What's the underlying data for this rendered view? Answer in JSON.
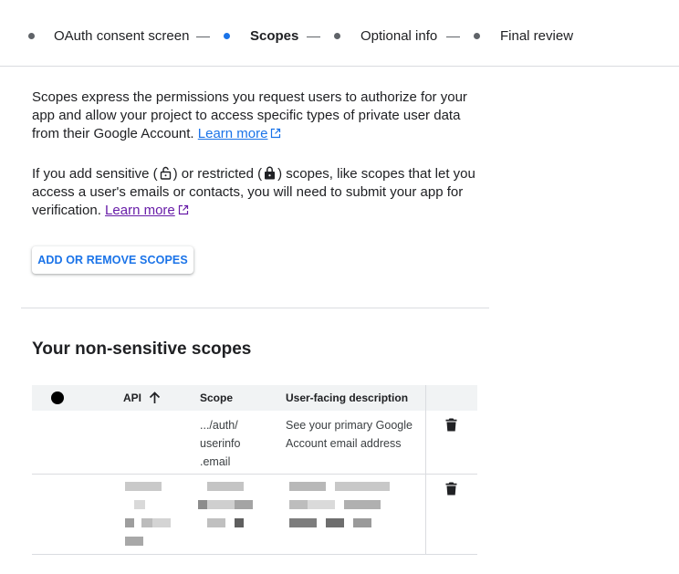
{
  "stepper": {
    "steps": [
      {
        "label": "OAuth consent screen",
        "active": false
      },
      {
        "label": "Scopes",
        "active": true
      },
      {
        "label": "Optional info",
        "active": false
      },
      {
        "label": "Final review",
        "active": false
      }
    ]
  },
  "intro": {
    "p1_text": "Scopes express the permissions you request users to authorize for your app and allow your project to access specific types of private user data from their Google Account.",
    "p1_link": "Learn more",
    "p2_text_a": "If you add sensitive (",
    "p2_text_b": ") or restricted (",
    "p2_text_c": ") scopes, like scopes that let you access a user's emails or contacts, you will need to submit your app for verification.",
    "p2_link": "Learn more"
  },
  "add_button_label": "ADD OR REMOVE SCOPES",
  "section_title": "Your non-sensitive scopes",
  "table": {
    "headers": {
      "api": "API",
      "scope": "Scope",
      "description": "User-facing description"
    },
    "rows": [
      {
        "api": "",
        "scope_lines": [
          ".../auth/",
          "userinfo",
          ".email"
        ],
        "description_lines": [
          "See your primary Google",
          "Account email address"
        ]
      }
    ]
  },
  "colors": {
    "accent": "#1a73e8",
    "visited_link": "#681da8",
    "text": "#202124"
  },
  "icons": [
    "external-link-icon",
    "unlocked-lock-icon",
    "locked-lock-icon",
    "sort-arrow-up-icon",
    "trash-icon"
  ]
}
